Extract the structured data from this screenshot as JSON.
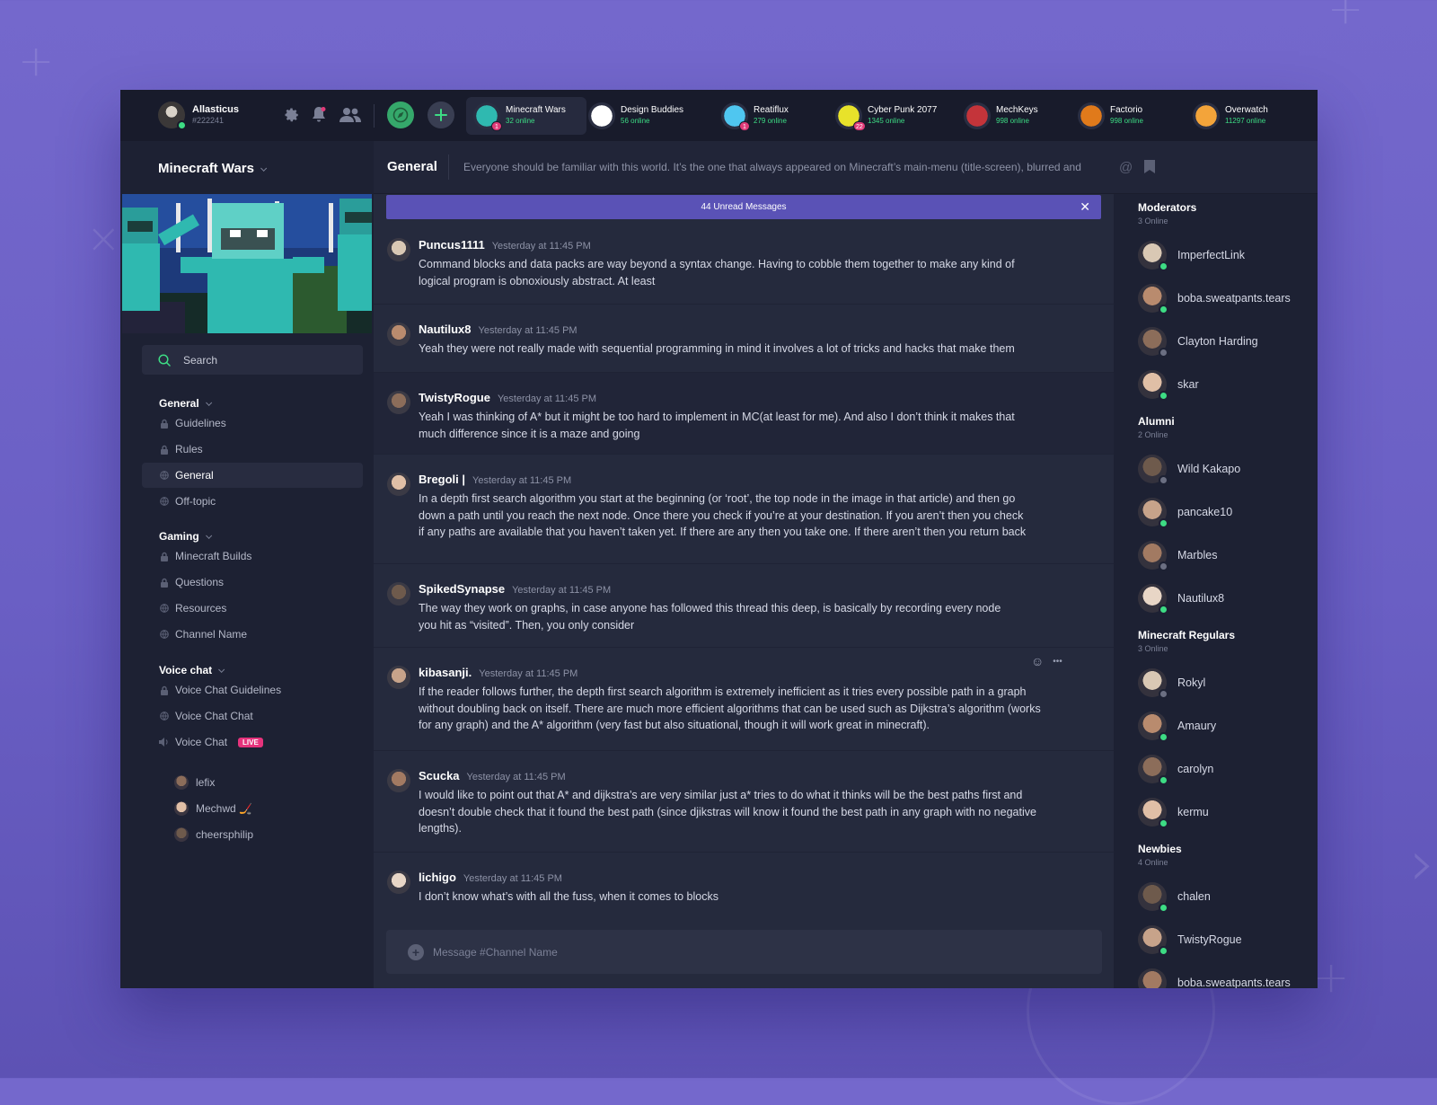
{
  "user": {
    "name": "Allasticus",
    "tag": "#222241"
  },
  "icons": {
    "settings": "gear-icon",
    "notifications": "bell-icon",
    "friends": "people-icon",
    "explore": "compass-icon",
    "add_server": "plus-icon"
  },
  "servers": [
    {
      "name": "Minecraft Wars",
      "online": "32 online",
      "badge": "1",
      "color": "#2fb9b0"
    },
    {
      "name": "Design Buddies",
      "online": "56 online",
      "badge": "",
      "color": "#ffffff"
    },
    {
      "name": "Reatiflux",
      "online": "279 online",
      "badge": "1",
      "color": "#4fc6f0"
    },
    {
      "name": "Cyber Punk 2077",
      "online": "1345 online",
      "badge": "22",
      "color": "#e8e22a"
    },
    {
      "name": "MechKeys",
      "online": "998 online",
      "badge": "",
      "color": "#c4343a"
    },
    {
      "name": "Factorio",
      "online": "998 online",
      "badge": "",
      "color": "#e07a1b"
    },
    {
      "name": "Overwatch",
      "online": "11297 online",
      "badge": "",
      "color": "#f3a43a"
    }
  ],
  "server_name": "Minecraft Wars",
  "search": {
    "placeholder": "Search"
  },
  "categories": [
    {
      "name": "General",
      "channels": [
        {
          "name": "Guidelines",
          "icon": "lock-icon"
        },
        {
          "name": "Rules",
          "icon": "lock-icon"
        },
        {
          "name": "General",
          "icon": "globe-icon",
          "active": true
        },
        {
          "name": "Off-topic",
          "icon": "globe-icon"
        }
      ]
    },
    {
      "name": "Gaming",
      "channels": [
        {
          "name": "Minecraft Builds",
          "icon": "lock-icon"
        },
        {
          "name": "Questions",
          "icon": "lock-icon"
        },
        {
          "name": "Resources",
          "icon": "globe-icon"
        },
        {
          "name": "Channel Name",
          "icon": "globe-icon"
        }
      ]
    },
    {
      "name": "Voice chat",
      "channels": [
        {
          "name": "Voice Chat Guidelines",
          "icon": "lock-icon"
        },
        {
          "name": "Voice Chat Chat",
          "icon": "globe-icon"
        },
        {
          "name": "Voice Chat",
          "icon": "speaker-icon",
          "live": "LIVE"
        }
      ]
    }
  ],
  "voice_users": [
    "lefix",
    "Mechwd 🏒",
    "cheersphilip"
  ],
  "channel": {
    "name": "General",
    "topic": "Everyone should be familiar with this world. It’s the one that always appeared on Minecraft’s main-menu (title-screen), blurred and"
  },
  "unread": "44 Unread Messages",
  "messages": [
    {
      "author": "Puncus1111",
      "time": "Yesterday at 11:45 PM",
      "lines": [
        "Command blocks and data packs are way beyond a syntax change. Having to cobble them together to make any kind of",
        "logical program is obnoxiously abstract. At least"
      ]
    },
    {
      "author": "Nautilux8",
      "time": "Yesterday at 11:45 PM",
      "lines": [
        "Yeah they were not really made with sequential programming in mind it involves a lot of tricks and hacks that make them"
      ]
    },
    {
      "author": "TwistyRogue",
      "time": "Yesterday at 11:45 PM",
      "lines": [
        "Yeah I was thinking of A* but it might be too hard to implement in MC(at least for me). And also I don’t think it makes that",
        "much difference since it is a maze and going"
      ]
    },
    {
      "author": "Bregoli |",
      "time": "Yesterday at 11:45 PM",
      "lines": [
        "In a depth first search algorithm you start at the beginning (or ‘root’, the top node in the image in that article) and then go",
        "down a path until you reach the next node. Once there you check if you’re at your destination. If you aren’t then you check",
        "if any paths are available that you haven’t taken yet. If there are any then you take one. If there aren’t then you return back"
      ]
    },
    {
      "author": "SpikedSynapse",
      "time": "Yesterday at 11:45 PM",
      "lines": [
        "The way they work on graphs, in case anyone has followed this thread this deep, is basically by recording every node",
        "you hit as “visited”. Then, you only consider"
      ]
    },
    {
      "author": "kibasanji.",
      "time": "Yesterday at 11:45 PM",
      "lines": [
        "If the reader follows further, the depth first search algorithm is extremely inefficient as it tries every possible path in a graph",
        "without doubling back on itself. There are much more efficient algorithms that can be used such as Dijkstra’s algorithm (works",
        "for any graph) and the A* algorithm (very fast but also situational, though it will work great in minecraft)."
      ]
    },
    {
      "author": "Scucka",
      "time": "Yesterday at 11:45 PM",
      "lines": [
        "I would like to point out that A* and dijkstra’s are very similar just a* tries to do what it thinks will be the best paths first and",
        "doesn’t double check that it found the best path (since djikstras will know it found the best path in any graph with no negative",
        "lengths)."
      ]
    },
    {
      "author": "lichigo",
      "time": "Yesterday at 11:45 PM",
      "lines": [
        "I don’t know what’s with all the fuss, when it comes to blocks"
      ]
    }
  ],
  "composer": {
    "placeholder": "Message #Channel Name"
  },
  "member_groups": [
    {
      "title": "Moderators",
      "count": "3 Online",
      "members": [
        {
          "name": "ImperfectLink",
          "online": true
        },
        {
          "name": "boba.sweatpants.tears",
          "online": true
        },
        {
          "name": "Clayton Harding",
          "online": false
        },
        {
          "name": "skar",
          "online": true
        }
      ]
    },
    {
      "title": "Alumni",
      "count": "2 Online",
      "members": [
        {
          "name": "Wild Kakapo",
          "online": false
        },
        {
          "name": "pancake10",
          "online": true
        },
        {
          "name": "Marbles",
          "online": false
        },
        {
          "name": "Nautilux8",
          "online": true
        }
      ]
    },
    {
      "title": "Minecraft Regulars",
      "count": "3 Online",
      "members": [
        {
          "name": "Rokyl",
          "online": false
        },
        {
          "name": "Amaury",
          "online": true
        },
        {
          "name": "carolyn",
          "online": true
        },
        {
          "name": "kermu",
          "online": true
        }
      ]
    },
    {
      "title": "Newbies",
      "count": "4 Online",
      "members": [
        {
          "name": "chalen",
          "online": true
        },
        {
          "name": "TwistyRogue",
          "online": true
        },
        {
          "name": "boba.sweatpants.tears",
          "online": true
        }
      ]
    }
  ]
}
